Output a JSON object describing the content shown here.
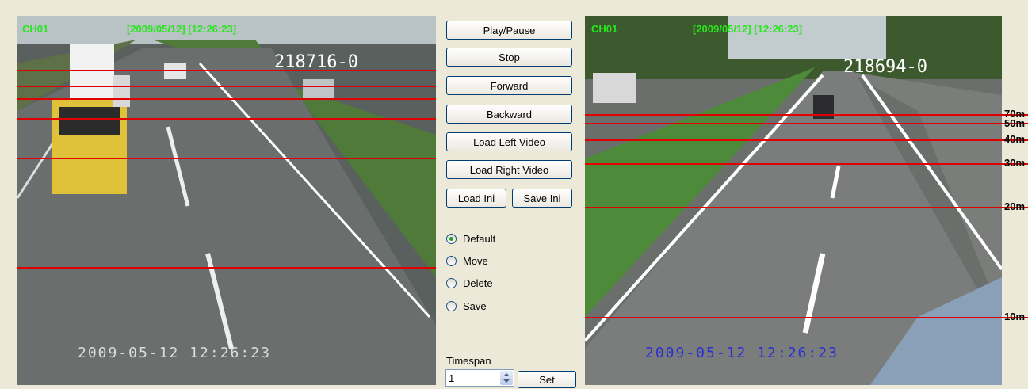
{
  "left_video": {
    "channel": "CH01",
    "datetime": "[2009/05/12] [12:26:23]",
    "plate": "218716-0",
    "timestamp": "2009-05-12   12:26:23"
  },
  "right_video": {
    "channel": "CH01",
    "datetime": "[2009/05/12] [12:26:23]",
    "plate": "218694-0",
    "timestamp": "2009-05-12   12:26:23",
    "distance_labels": [
      "70m",
      "50m",
      "40m",
      "30m",
      "20m",
      "10m"
    ]
  },
  "controls": {
    "play_pause": "Play/Pause",
    "stop": "Stop",
    "forward": "Forward",
    "backward": "Backward",
    "load_left_video": "Load Left Video",
    "load_right_video": "Load Right Video",
    "load_ini": "Load Ini",
    "save_ini": "Save Ini"
  },
  "modes": {
    "selected": "Default",
    "options": [
      "Default",
      "Move",
      "Delete",
      "Save"
    ]
  },
  "timespan": {
    "label": "Timespan",
    "value": "1",
    "set_label": "Set"
  },
  "colors": {
    "osd_green": "#27e61e",
    "guide_line_red": "#e00000",
    "timestamp_left": "#dddddd",
    "timestamp_right": "#2b2fd0"
  }
}
